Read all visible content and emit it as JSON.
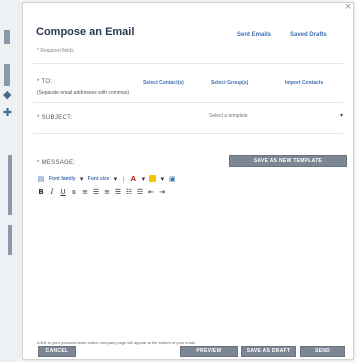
{
  "window": {
    "close_glyph": "×"
  },
  "header": {
    "title": "Compose an Email",
    "sent_emails": "Sent Emails",
    "saved_drafts": "Saved Drafts",
    "required": "* Required fields"
  },
  "to": {
    "label": "* TO:",
    "select_contacts": "Select Contact(s)",
    "select_groups": "Select Group(s)",
    "import_contacts": "Import Contacts",
    "hint": "(Separate email addresses with commas)"
  },
  "subject": {
    "label": "* SUBJECT:",
    "template_value": "Select a template",
    "arrow": "▾"
  },
  "message": {
    "label": "* MESSAGE:",
    "save_template_button": "SAVE AS NEW TEMPLATE"
  },
  "toolbar": {
    "font_family": "Font family",
    "font_size": "Font size",
    "bold": "B",
    "italic": "I",
    "underline": "U",
    "colors": {
      "text_color": "#c0392b",
      "bg_color": "#f1c40f",
      "accent": "#3f72b5"
    }
  },
  "footer": {
    "note": "A link to your personal team and/or company page will appear at the bottom of your email",
    "cancel": "CANCEL",
    "preview": "PREVIEW",
    "save_as_draft": "SAVE AS DRAFT",
    "send": "SEND"
  }
}
